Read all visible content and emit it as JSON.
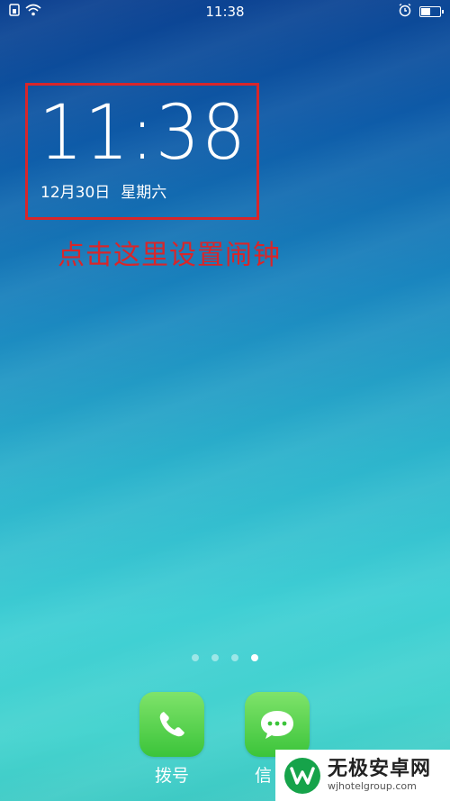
{
  "status_bar": {
    "time": "11:38",
    "icons": [
      "sim-icon",
      "wifi-icon",
      "alarm-icon",
      "battery-icon"
    ],
    "battery_level": 0.5
  },
  "clock_widget": {
    "time": "11:38",
    "date": "12月30日",
    "weekday": "星期六",
    "highlight_color": "#d8262a"
  },
  "annotation": {
    "text": "点击这里设置闹钟",
    "color": "#d8262a"
  },
  "page_indicator": {
    "count": 4,
    "active_index": 3
  },
  "dock": {
    "apps": [
      {
        "label": "拨号",
        "icon": "phone-icon"
      },
      {
        "label": "信",
        "icon": "message-icon"
      }
    ]
  },
  "watermark": {
    "title": "无极安卓网",
    "url": "wjhotelgroup.com",
    "logo_icon": "w-logo-icon"
  }
}
